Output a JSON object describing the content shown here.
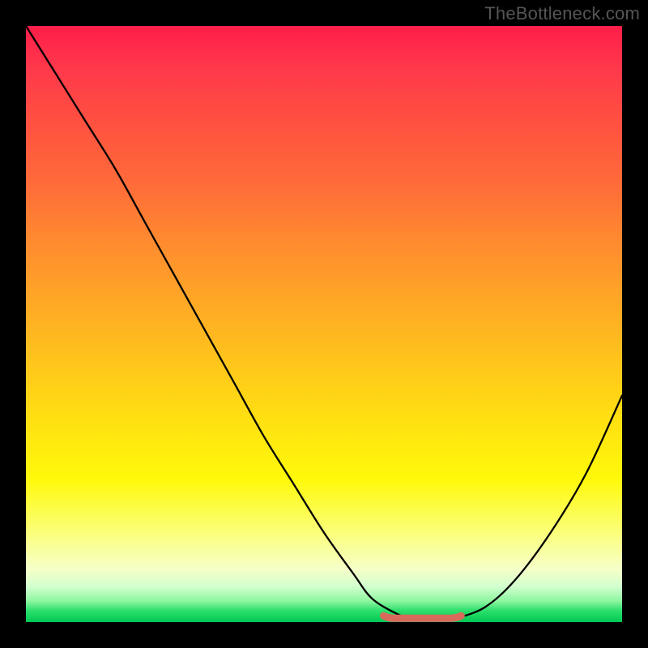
{
  "watermark": "TheBottleneck.com",
  "chart_data": {
    "type": "line",
    "title": "",
    "xlabel": "",
    "ylabel": "",
    "xlim": [
      0,
      100
    ],
    "ylim": [
      0,
      100
    ],
    "grid": false,
    "legend": false,
    "series": [
      {
        "name": "curve",
        "x": [
          0,
          5,
          10,
          15,
          20,
          25,
          30,
          35,
          40,
          45,
          50,
          55,
          58,
          62,
          65,
          70,
          72,
          77,
          82,
          88,
          94,
          100
        ],
        "y": [
          100,
          92,
          84,
          76,
          67,
          58,
          49,
          40,
          31,
          23,
          15,
          8,
          4,
          1.5,
          0.5,
          0.4,
          0.6,
          2.5,
          7,
          15,
          25,
          38
        ]
      }
    ],
    "annotations": {
      "flat_optimal_region": {
        "x_start": 60,
        "x_end": 73,
        "y": 0.5
      }
    },
    "background_gradient": {
      "top": "#ff1e4a",
      "mid_upper": "#ffa726",
      "mid_lower": "#fff90a",
      "bottom": "#00c853"
    }
  }
}
